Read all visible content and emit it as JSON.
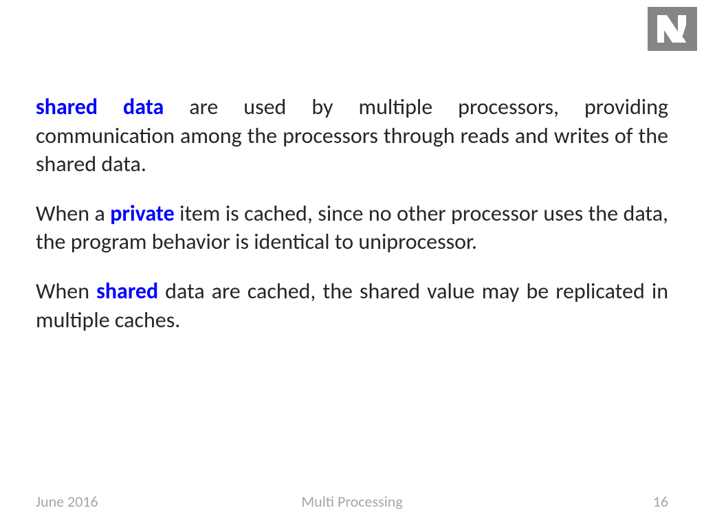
{
  "content": {
    "p1": {
      "keyword1": "shared data",
      "text1": " are used by multiple processors, providing communication among the processors through reads and writes of the shared data."
    },
    "p2": {
      "text1": "When a ",
      "keyword1": "private",
      "text2": " item is cached, since no other processor uses the data, the program behavior is identical to uniprocessor."
    },
    "p3": {
      "text1": "When ",
      "keyword1": "shared",
      "text2": " data are cached, the shared value may be replicated in multiple caches."
    }
  },
  "footer": {
    "date": "June 2016",
    "title": "Multi Processing",
    "page": "16"
  }
}
